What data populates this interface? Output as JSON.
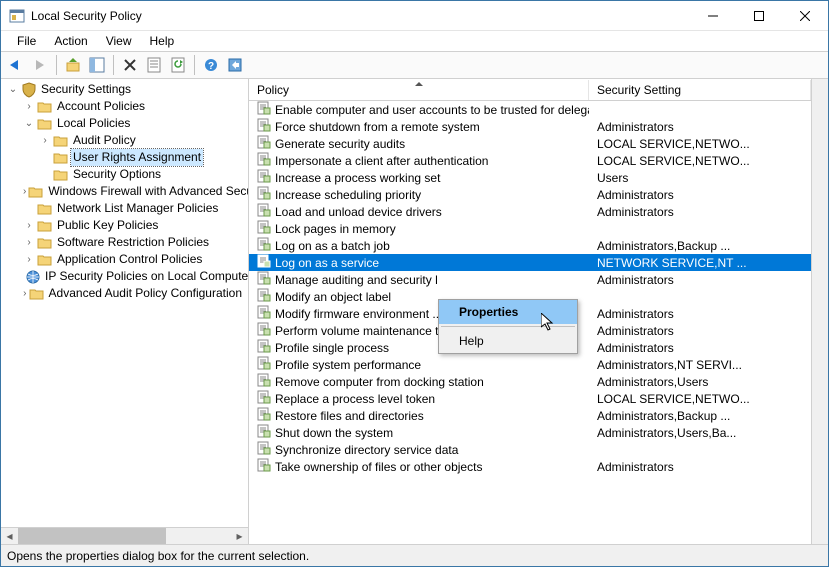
{
  "window": {
    "title": "Local Security Policy"
  },
  "menubar": [
    "File",
    "Action",
    "View",
    "Help"
  ],
  "tree": {
    "root": {
      "label": "Security Settings",
      "children": [
        {
          "label": "Account Policies",
          "expander": "›",
          "icon": "folder"
        },
        {
          "label": "Local Policies",
          "expander": "⌄",
          "icon": "folder",
          "expanded": true,
          "children": [
            {
              "label": "Audit Policy",
              "expander": "›",
              "icon": "folder"
            },
            {
              "label": "User Rights Assignment",
              "expander": "",
              "icon": "folder",
              "selected": true
            },
            {
              "label": "Security Options",
              "expander": "",
              "icon": "folder"
            }
          ]
        },
        {
          "label": "Windows Firewall with Advanced Security",
          "expander": "›",
          "icon": "folder"
        },
        {
          "label": "Network List Manager Policies",
          "expander": "",
          "icon": "folder"
        },
        {
          "label": "Public Key Policies",
          "expander": "›",
          "icon": "folder"
        },
        {
          "label": "Software Restriction Policies",
          "expander": "›",
          "icon": "folder"
        },
        {
          "label": "Application Control Policies",
          "expander": "›",
          "icon": "folder"
        },
        {
          "label": "IP Security Policies on Local Computer",
          "expander": "",
          "icon": "ipsec"
        },
        {
          "label": "Advanced Audit Policy Configuration",
          "expander": "›",
          "icon": "folder"
        }
      ]
    }
  },
  "columns": {
    "policy": "Policy",
    "setting": "Security Setting"
  },
  "policies": [
    {
      "name": "Enable computer and user accounts to be trusted for delega...",
      "setting": ""
    },
    {
      "name": "Force shutdown from a remote system",
      "setting": "Administrators"
    },
    {
      "name": "Generate security audits",
      "setting": "LOCAL SERVICE,NETWO..."
    },
    {
      "name": "Impersonate a client after authentication",
      "setting": "LOCAL SERVICE,NETWO..."
    },
    {
      "name": "Increase a process working set",
      "setting": "Users"
    },
    {
      "name": "Increase scheduling priority",
      "setting": "Administrators"
    },
    {
      "name": "Load and unload device drivers",
      "setting": "Administrators"
    },
    {
      "name": "Lock pages in memory",
      "setting": ""
    },
    {
      "name": "Log on as a batch job",
      "setting": "Administrators,Backup ..."
    },
    {
      "name": "Log on as a service",
      "setting": "NETWORK SERVICE,NT ...",
      "selected": true
    },
    {
      "name": "Manage auditing and security l",
      "setting": "Administrators"
    },
    {
      "name": "Modify an object label",
      "setting": ""
    },
    {
      "name": "Modify firmware environment ...",
      "setting": "Administrators"
    },
    {
      "name": "Perform volume maintenance tasks",
      "setting": "Administrators"
    },
    {
      "name": "Profile single process",
      "setting": "Administrators"
    },
    {
      "name": "Profile system performance",
      "setting": "Administrators,NT SERVI..."
    },
    {
      "name": "Remove computer from docking station",
      "setting": "Administrators,Users"
    },
    {
      "name": "Replace a process level token",
      "setting": "LOCAL SERVICE,NETWO..."
    },
    {
      "name": "Restore files and directories",
      "setting": "Administrators,Backup ..."
    },
    {
      "name": "Shut down the system",
      "setting": "Administrators,Users,Ba..."
    },
    {
      "name": "Synchronize directory service data",
      "setting": ""
    },
    {
      "name": "Take ownership of files or other objects",
      "setting": "Administrators"
    }
  ],
  "context_menu": {
    "items": [
      {
        "label": "Properties",
        "hover": true
      },
      {
        "sep": true
      },
      {
        "label": "Help"
      }
    ]
  },
  "statusbar": "Opens the properties dialog box for the current selection."
}
